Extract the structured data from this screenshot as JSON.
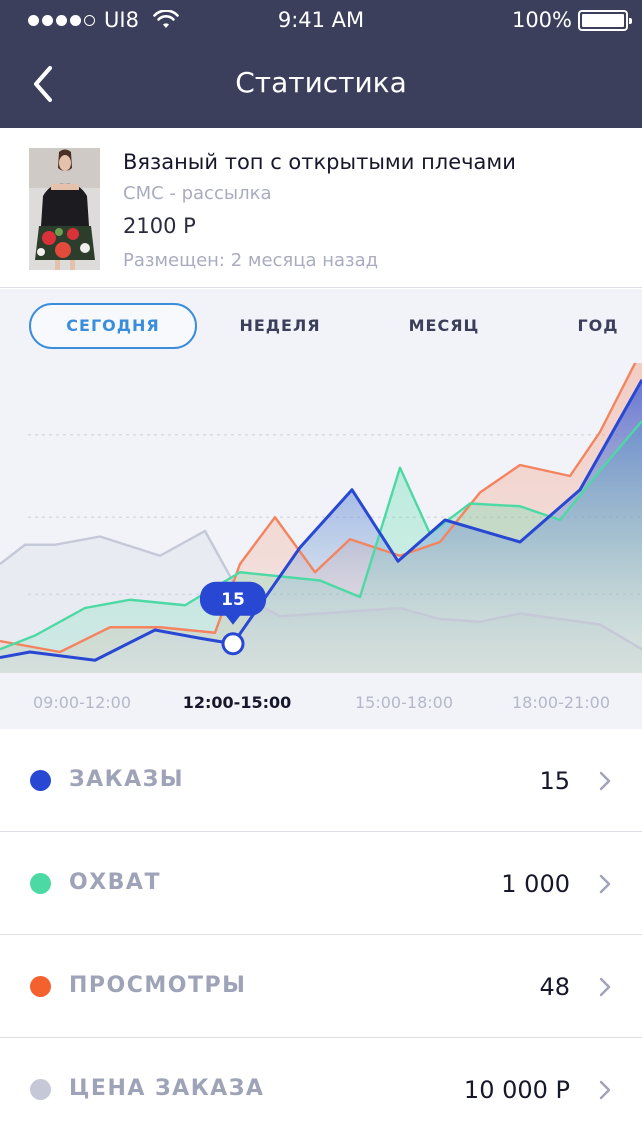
{
  "status_bar": {
    "carrier": "UI8",
    "time": "9:41 AM",
    "battery": "100%"
  },
  "nav": {
    "title": "Статистика"
  },
  "product": {
    "name": "Вязаный топ с открытыми  плечами",
    "channel": "СМС - рассылка",
    "price": "2100 Р",
    "posted": "Размещен: 2 месяца назад"
  },
  "tabs": [
    {
      "label": "СЕГОДНЯ",
      "active": true
    },
    {
      "label": "НЕДЕЛЯ",
      "active": false
    },
    {
      "label": "МЕСЯЦ",
      "active": false
    },
    {
      "label": "ГОД",
      "active": false
    }
  ],
  "chart_data": {
    "type": "line",
    "x_labels": [
      "09:00-12:00",
      "12:00-15:00",
      "15:00-18:00",
      "18:00-21:00"
    ],
    "active_x_label": "12:00-15:00",
    "tooltip": {
      "value": "15",
      "series": "orders"
    },
    "ylim": [
      0,
      100
    ],
    "grid": true,
    "series": [
      {
        "id": "price",
        "color": "#c5c8d6",
        "x": [
          0,
          25,
          55,
          100,
          160,
          205,
          240,
          280,
          320,
          360,
          400,
          440,
          480,
          520,
          560,
          600,
          642
        ],
        "values": [
          36,
          43,
          43,
          46,
          39,
          48,
          25,
          17,
          18,
          19,
          20,
          16,
          15,
          18,
          16,
          14,
          5
        ]
      },
      {
        "id": "reach",
        "color": "#4dd9a3",
        "x": [
          0,
          35,
          85,
          130,
          185,
          240,
          320,
          360,
          400,
          430,
          470,
          520,
          560,
          600,
          642
        ],
        "values": [
          5,
          10,
          20,
          23,
          21,
          33,
          30,
          24,
          71,
          47,
          58,
          57,
          52,
          70,
          88
        ]
      },
      {
        "id": "views",
        "color": "#f4845f",
        "x": [
          0,
          60,
          110,
          160,
          215,
          240,
          275,
          315,
          350,
          400,
          440,
          480,
          520,
          570,
          600,
          642
        ],
        "values": [
          8,
          4,
          13,
          13,
          11,
          36,
          53,
          33,
          45,
          39,
          44,
          62,
          72,
          68,
          84,
          114
        ]
      },
      {
        "id": "orders",
        "color": "#2848d4",
        "x": [
          0,
          30,
          95,
          155,
          200,
          233,
          300,
          352,
          398,
          445,
          520,
          580,
          642
        ],
        "values": [
          2,
          4,
          1,
          12,
          9,
          7,
          42,
          63,
          37,
          52,
          44,
          63,
          103
        ]
      }
    ]
  },
  "metrics": [
    {
      "label": "ЗАКАЗЫ",
      "value": "15",
      "color": "#2848d4"
    },
    {
      "label": "ОХВАТ",
      "value": "1 000",
      "color": "#4dd9a3"
    },
    {
      "label": "ПРОСМОТРЫ",
      "value": "48",
      "color": "#f4612f"
    },
    {
      "label": "ЦЕНА ЗАКАЗА",
      "value": "10 000 Р",
      "color": "#c5c8d6"
    }
  ],
  "icons": {
    "back": "chevron-left-icon",
    "row_arrow": "chevron-right-icon",
    "wifi": "wifi-icon",
    "battery": "battery-icon"
  }
}
